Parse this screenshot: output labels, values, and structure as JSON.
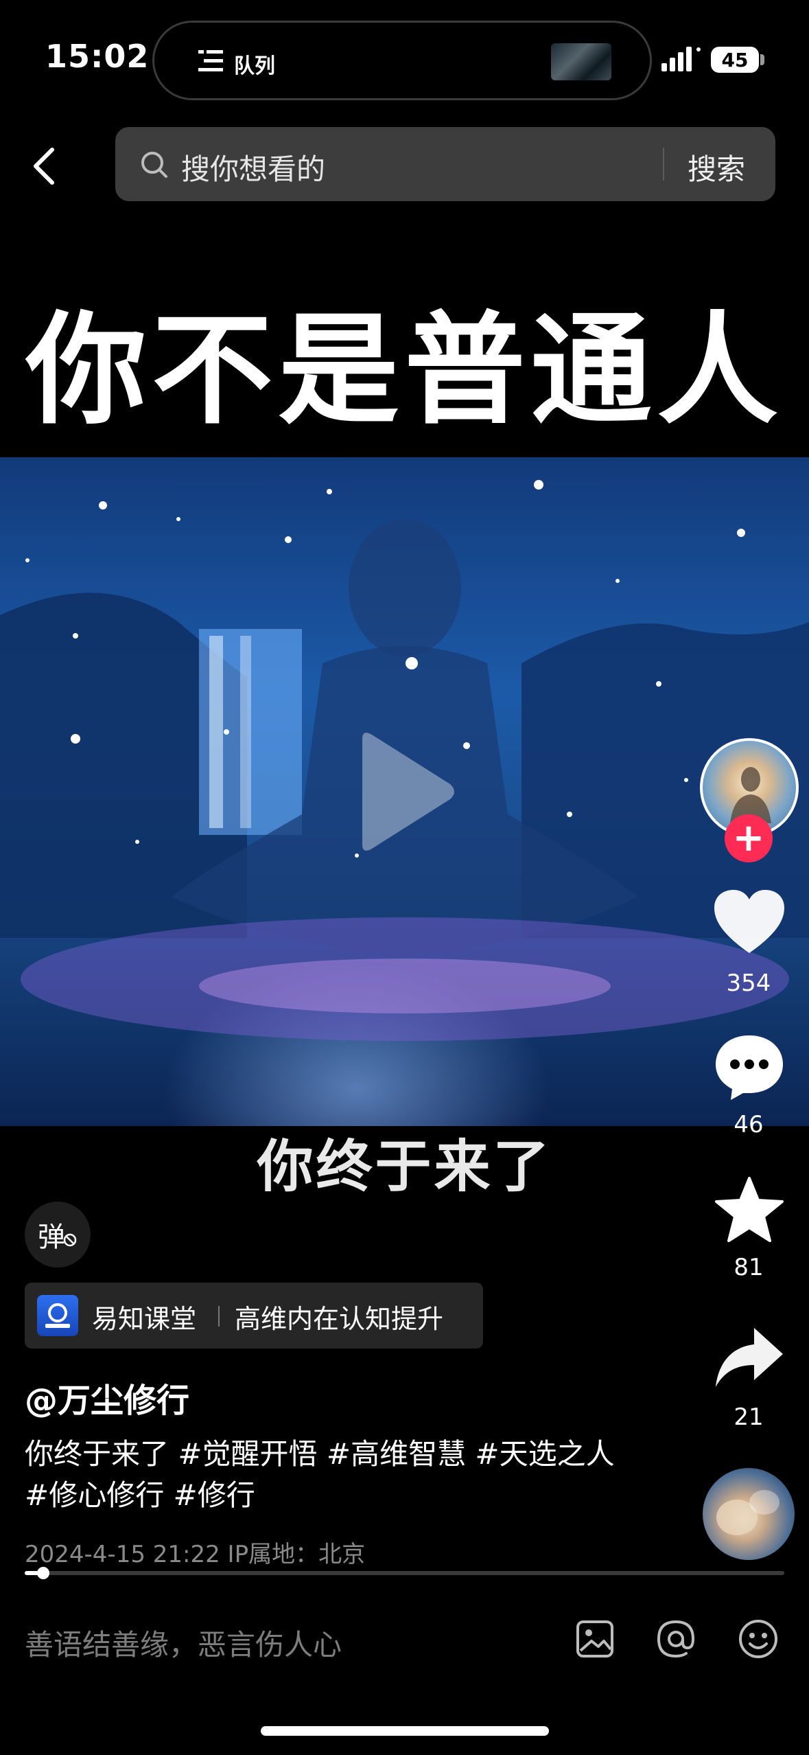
{
  "status_bar": {
    "time": "15:02",
    "island_label": "队列",
    "battery": "45"
  },
  "search": {
    "placeholder": "搜你想看的",
    "button": "搜索"
  },
  "video": {
    "headline": "你不是普通人",
    "subtitle": "你终于来了"
  },
  "rail": {
    "likes": "354",
    "comments": "46",
    "favorites": "81",
    "shares": "21"
  },
  "danmu_label": "弹",
  "course_tag": {
    "name": "易知课堂",
    "desc": "高维内在认知提升"
  },
  "post": {
    "author": "@万尘修行",
    "caption": "你终于来了 #觉醒开悟 #高维智慧 #天选之人 #修心修行 #修行",
    "meta": "2024-4-15 21:22  IP属地：北京",
    "progress": 0.02
  },
  "comment_bar": {
    "placeholder": "善语结善缘，恶言伤人心"
  },
  "colors": {
    "follow": "#fe2c55",
    "search_bg": "#3d3d3d"
  },
  "icons": [
    "back-arrow-icon",
    "search-icon",
    "queue-icon",
    "signal-icon",
    "heart-icon",
    "comment-icon",
    "star-icon",
    "share-icon",
    "image-icon",
    "at-icon",
    "emoji-icon",
    "play-icon"
  ]
}
